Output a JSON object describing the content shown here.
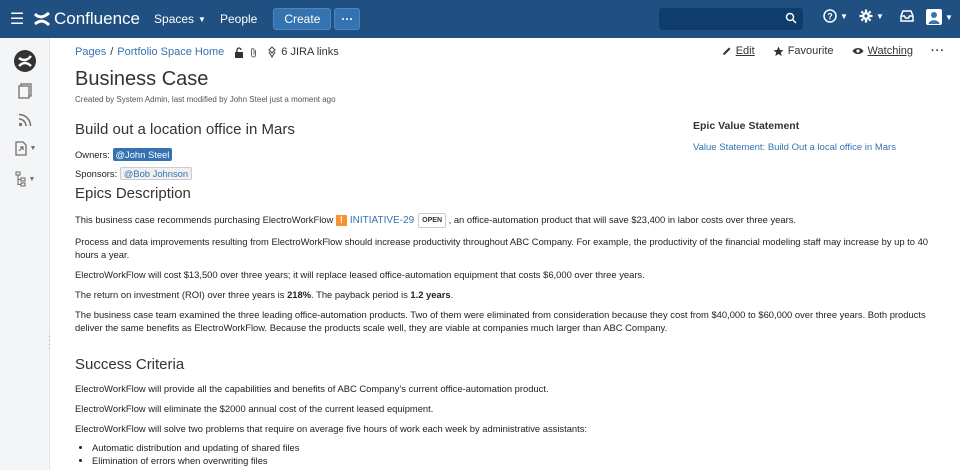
{
  "topbar": {
    "product": "Confluence",
    "spaces": "Spaces",
    "people": "People",
    "create": "Create",
    "more": "···",
    "search_placeholder": ""
  },
  "breadcrumb": {
    "pages": "Pages",
    "sep": "/",
    "space_home": "Portfolio Space Home",
    "jira_links": "6 JIRA links"
  },
  "actions": {
    "edit": "Edit",
    "favourite": "Favourite",
    "watching": "Watching",
    "more": "···"
  },
  "page": {
    "title": "Business Case",
    "meta": "Created by System Admin, last modified by John Steel just a moment ago",
    "heading1": "Build out a location office in Mars",
    "owners_label": "Owners:",
    "owner": "@John Steel",
    "sponsors_label": "Sponsors:",
    "sponsor": "@Bob Johnson",
    "epics_heading": "Epics Description",
    "para1_before": "This business case recommends purchasing ElectroWorkFlow",
    "para1_after": ", an office-automation product that will save $23,400 in labor costs over three years.",
    "jira_key": "INITIATIVE-29",
    "jira_status": "OPEN",
    "para2": "Process and data improvements resulting from ElectroWorkFlow should increase productivity throughout ABC Company. For example, the productivity of the financial modeling staff may increase by up to 40 hours a year.",
    "para3": "ElectroWorkFlow will cost $13,500 over three years; it will replace leased office-automation equipment that costs $6,000 over three years.",
    "para4_a": "The return on investment (ROI) over three years is ",
    "para4_b": "218%",
    "para4_c": ". The payback period is ",
    "para4_d": "1.2 years",
    "para4_e": ".",
    "para5": "The business case team examined the three leading office-automation products. Two of them were eliminated from consideration because they cost from $40,000 to $60,000 over three years. Both products deliver the same benefits as ElectroWorkFlow. Because the products scale well, they are viable at companies much larger than ABC Company.",
    "success_heading": "Success Criteria",
    "sc1": "ElectroWorkFlow will provide all the capabilities and benefits of ABC Company's current office-automation product.",
    "sc2": "ElectroWorkFlow will eliminate the $2000 annual cost of the current leased equipment.",
    "sc3": "ElectroWorkFlow will solve two problems that require on average five hours of work each week by administrative assistants:",
    "bullets": [
      "Automatic distribution and updating of shared files",
      "Elimination of errors when overwriting files"
    ]
  },
  "epic": {
    "title": "Epic Value Statement",
    "link": "Value Statement: Build Out a local office in Mars"
  },
  "colors": {
    "topbar": "#205081",
    "link": "#3572b0",
    "jira_icon": "#f79232"
  }
}
